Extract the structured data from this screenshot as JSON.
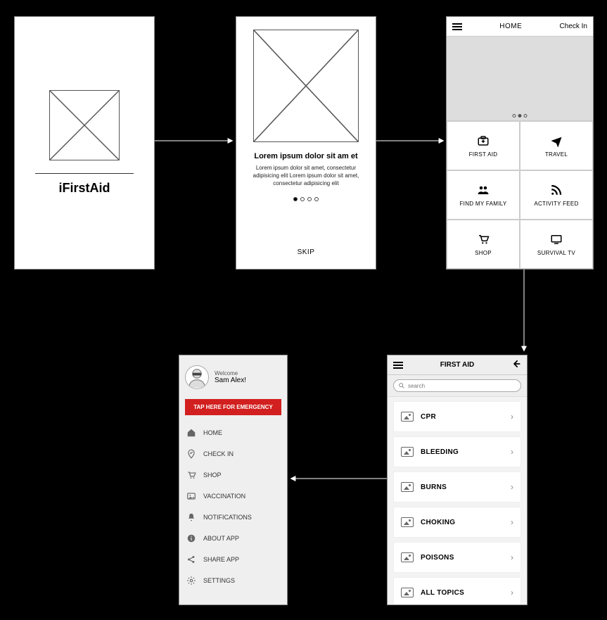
{
  "splash": {
    "title": "iFirstAid"
  },
  "onboard": {
    "heading": "Lorem ipsum dolor sit am et",
    "body": "Lorem ipsum dolor sit amet, consectetur adipisicing elit Lorem ipsum dolor sit amet, consectetur adipisicing elit",
    "dots_total": 4,
    "dots_active": 0,
    "skip_label": "SKIP"
  },
  "home": {
    "title": "HOME",
    "check_in": "Check In",
    "carousel_active": 1,
    "carousel_total": 3,
    "tiles": [
      {
        "label": "FIRST AID",
        "icon": "firstaid-icon"
      },
      {
        "label": "TRAVEL",
        "icon": "plane-icon"
      },
      {
        "label": "FIND MY FAMILY",
        "icon": "family-icon"
      },
      {
        "label": "ACTIVITY FEED",
        "icon": "rss-icon"
      },
      {
        "label": "SHOP",
        "icon": "cart-icon"
      },
      {
        "label": "SURVIVAL TV",
        "icon": "tv-icon"
      }
    ]
  },
  "firstaid": {
    "title": "FIRST AID",
    "search_placeholder": "search",
    "items": [
      {
        "label": "CPR"
      },
      {
        "label": "BLEEDING"
      },
      {
        "label": "BURNS"
      },
      {
        "label": "CHOKING"
      },
      {
        "label": "POISONS"
      },
      {
        "label": "ALL TOPICS"
      }
    ]
  },
  "drawer": {
    "welcome": "Welcome",
    "name": "Sam Alex!",
    "emergency_label": "TAP HERE FOR EMERGENCY",
    "items": [
      {
        "label": "HOME",
        "icon": "home-icon"
      },
      {
        "label": "CHECK IN",
        "icon": "checkin-icon"
      },
      {
        "label": "SHOP",
        "icon": "cart-icon"
      },
      {
        "label": "VACCINATION",
        "icon": "image-icon"
      },
      {
        "label": "NOTIFICATIONS",
        "icon": "bell-icon"
      },
      {
        "label": "ABOUT APP",
        "icon": "info-icon"
      },
      {
        "label": "SHARE APP",
        "icon": "share-icon"
      },
      {
        "label": "SETTINGS",
        "icon": "gear-icon"
      }
    ]
  }
}
